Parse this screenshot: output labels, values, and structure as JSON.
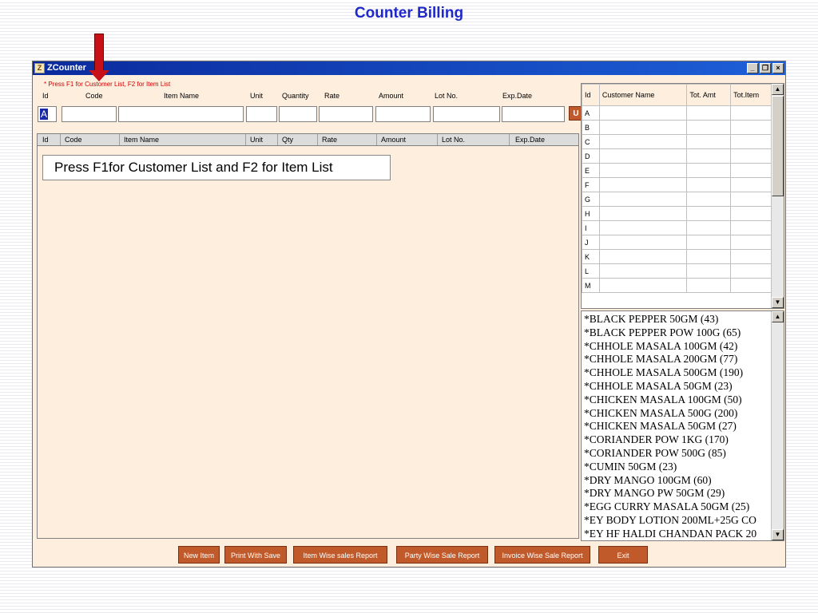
{
  "slide": {
    "title": "Counter Billing"
  },
  "window": {
    "title": "ZCounter",
    "icon_text": "Z",
    "controls": {
      "minimize": "_",
      "restore": "❐",
      "close": "×"
    }
  },
  "hint": "* Press F1 for Customer List, F2 for Item List",
  "entry_headers": [
    "Id",
    "Code",
    "Item Name",
    "Unit",
    "Quantity",
    "Rate",
    "Amount",
    "Lot No.",
    "Exp.Date"
  ],
  "entry": {
    "id_value": "A",
    "u_button": "U"
  },
  "grid": {
    "columns": [
      "Id",
      "Code",
      "Item Name",
      "Unit",
      "Qty",
      "Rate",
      "Amount",
      "Lot No.",
      "Exp.Date"
    ],
    "callout": "Press F1for Customer List and F2 for Item List"
  },
  "customer_table": {
    "columns": [
      "Id",
      "Customer Name",
      "Tot. Amt",
      "Tot.Item"
    ],
    "rows": [
      "A",
      "B",
      "C",
      "D",
      "E",
      "F",
      "G",
      "H",
      "I",
      "J",
      "K",
      "L",
      "M"
    ]
  },
  "item_list": [
    "*BLACK PEPPER 50GM (43)",
    "*BLACK PEPPER POW 100G (65)",
    "*CHHOLE MASALA 100GM (42)",
    "*CHHOLE MASALA 200GM (77)",
    "*CHHOLE MASALA 500GM (190)",
    "*CHHOLE MASALA 50GM (23)",
    "*CHICKEN MASALA 100GM (50)",
    "*CHICKEN MASALA 500G (200)",
    "*CHICKEN MASALA 50GM (27)",
    "*CORIANDER POW 1KG (170)",
    "*CORIANDER POW 500G (85)",
    "*CUMIN 50GM (23)",
    "*DRY MANGO 100GM (60)",
    "*DRY MANGO PW 50GM (29)",
    "*EGG CURRY MASALA 50GM (25)",
    "*EY BODY LOTION 200ML+25G CO",
    "*EY HF HALDI CHANDAN PACK 20"
  ],
  "buttons": {
    "new_item": "New Item",
    "print_with_save": "Print With Save",
    "item_wise_report": "Item Wise sales Report",
    "party_wise_report": "Party Wise Sale Report",
    "invoice_wise_report": "Invoice Wise Sale Report",
    "exit": "Exit"
  },
  "scroll": {
    "up": "▲",
    "down": "▼"
  },
  "colors": {
    "accent_button": "#c05a2a",
    "title_blue": "#1f28c8",
    "window_bg": "#fdeedd",
    "arrow_red": "#c81018"
  }
}
